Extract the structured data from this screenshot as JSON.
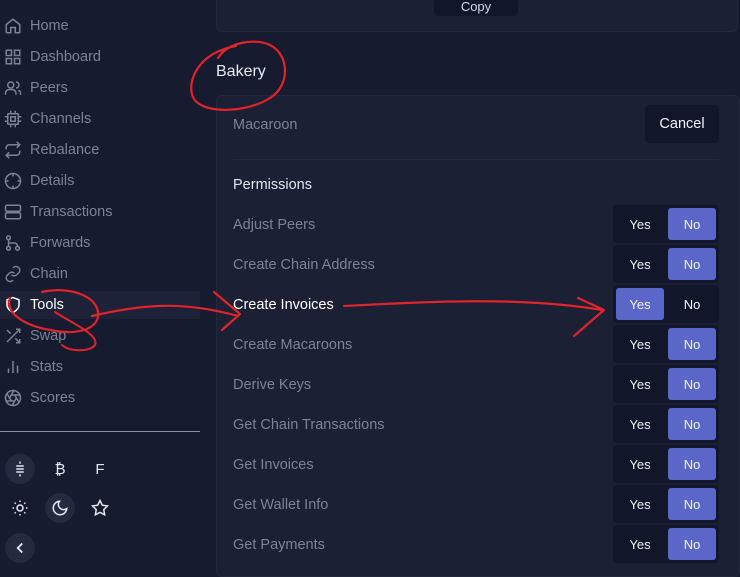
{
  "sidebar": {
    "items": [
      {
        "label": "Home",
        "icon": "home-icon"
      },
      {
        "label": "Dashboard",
        "icon": "grid-icon"
      },
      {
        "label": "Peers",
        "icon": "users-icon"
      },
      {
        "label": "Channels",
        "icon": "cpu-icon"
      },
      {
        "label": "Rebalance",
        "icon": "repeat-icon"
      },
      {
        "label": "Details",
        "icon": "crosshair-icon"
      },
      {
        "label": "Transactions",
        "icon": "server-icon"
      },
      {
        "label": "Forwards",
        "icon": "git-branch-icon"
      },
      {
        "label": "Chain",
        "icon": "link-icon"
      },
      {
        "label": "Tools",
        "icon": "shield-icon",
        "active": true
      },
      {
        "label": "Swap",
        "icon": "shuffle-icon"
      },
      {
        "label": "Stats",
        "icon": "bar-chart-icon"
      },
      {
        "label": "Scores",
        "icon": "aperture-icon"
      }
    ],
    "currency": {
      "bitcoin_symbol": "₿",
      "fiat_symbol": "F"
    },
    "icons": [
      "sats-icon",
      "sun-icon",
      "moon-icon",
      "star-icon",
      "chevron-left-icon"
    ]
  },
  "top": {
    "copy_label": "Copy"
  },
  "bakery": {
    "title": "Bakery",
    "macaroon_label": "Macaroon",
    "cancel_label": "Cancel",
    "permissions_label": "Permissions",
    "yes_label": "Yes",
    "no_label": "No",
    "permissions": [
      {
        "label": "Adjust Peers",
        "value": "No"
      },
      {
        "label": "Create Chain Address",
        "value": "No"
      },
      {
        "label": "Create Invoices",
        "value": "Yes"
      },
      {
        "label": "Create Macaroons",
        "value": "No"
      },
      {
        "label": "Derive Keys",
        "value": "No"
      },
      {
        "label": "Get Chain Transactions",
        "value": "No"
      },
      {
        "label": "Get Invoices",
        "value": "No"
      },
      {
        "label": "Get Wallet Info",
        "value": "No"
      },
      {
        "label": "Get Payments",
        "value": "No"
      }
    ]
  },
  "colors": {
    "background": "#161b2f",
    "card": "#1b2035",
    "toggle_active": "#5a67c9",
    "annotation": "#e0242b"
  }
}
